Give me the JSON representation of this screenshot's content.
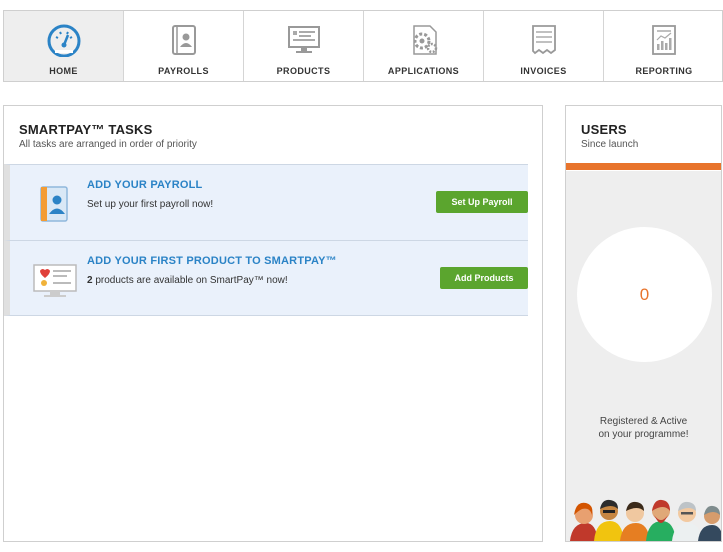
{
  "nav": {
    "items": [
      {
        "label": "HOME",
        "icon": "dashboard-icon",
        "active": true
      },
      {
        "label": "PAYROLLS",
        "icon": "contact-book-icon",
        "active": false
      },
      {
        "label": "PRODUCTS",
        "icon": "monitor-icon",
        "active": false
      },
      {
        "label": "APPLICATIONS",
        "icon": "gears-icon",
        "active": false
      },
      {
        "label": "INVOICES",
        "icon": "receipt-icon",
        "active": false
      },
      {
        "label": "REPORTING",
        "icon": "report-chart-icon",
        "active": false
      }
    ]
  },
  "tasks": {
    "title": "SMARTPAY™ TASKS",
    "subtitle": "All tasks are arranged in order of priority",
    "items": [
      {
        "title": "ADD YOUR PAYROLL",
        "description": "Set up your first payroll now!",
        "button": "Set Up Payroll",
        "icon": "payroll-book-icon"
      },
      {
        "title": "ADD YOUR FIRST PRODUCT TO SMARTPAY™",
        "description_count": "2",
        "description_rest": " products are available on SmartPay™ now!",
        "button": "Add Products",
        "icon": "product-monitor-icon"
      }
    ]
  },
  "users": {
    "title": "USERS",
    "subtitle": "Since launch",
    "count": "0",
    "note_line1": "Registered & Active",
    "note_line2": "on your programme!"
  },
  "colors": {
    "accent_blue": "#2b83c6",
    "button_green": "#5ba52e",
    "accent_orange": "#e8742c"
  }
}
